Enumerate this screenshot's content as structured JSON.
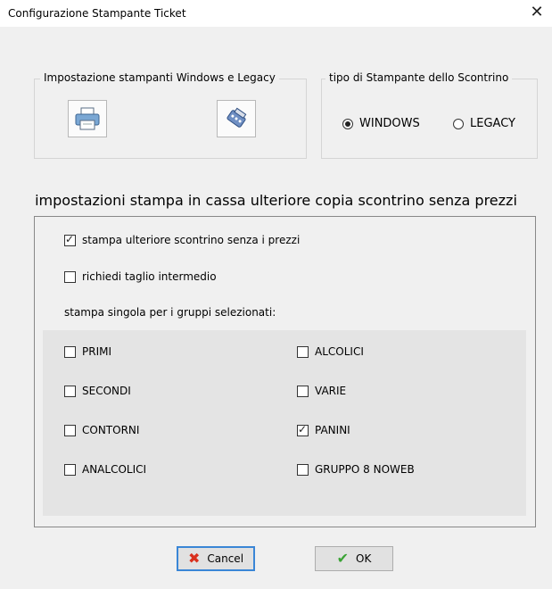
{
  "window": {
    "title": "Configurazione Stampante Ticket"
  },
  "printers_group": {
    "legend": "Impostazione stampanti Windows e Legacy",
    "windows_icon": "printer-icon",
    "legacy_icon": "legacy-printer-icon"
  },
  "type_group": {
    "legend": "tipo di Stampante dello Scontrino",
    "options": [
      {
        "label": "WINDOWS",
        "selected": true
      },
      {
        "label": "LEGACY",
        "selected": false
      }
    ]
  },
  "heading": "impostazioni stampa in cassa ulteriore copia scontrino senza prezzi",
  "options": [
    {
      "label": "stampa ulteriore scontrino senza i prezzi",
      "checked": true
    },
    {
      "label": "richiedi taglio intermedio",
      "checked": false
    }
  ],
  "groups_label": "stampa singola per i gruppi  selezionati:",
  "groups": [
    {
      "label": "PRIMI",
      "checked": false
    },
    {
      "label": "ALCOLICI",
      "checked": false
    },
    {
      "label": "SECONDI",
      "checked": false
    },
    {
      "label": "VARIE",
      "checked": false
    },
    {
      "label": "CONTORNI",
      "checked": false
    },
    {
      "label": "PANINI",
      "checked": true
    },
    {
      "label": "ANALCOLICI",
      "checked": false
    },
    {
      "label": "GRUPPO 8 NOWEB",
      "checked": false
    }
  ],
  "buttons": {
    "cancel": "Cancel",
    "ok": "OK",
    "cancel_color": "#d9301e",
    "ok_color": "#3aa335"
  }
}
